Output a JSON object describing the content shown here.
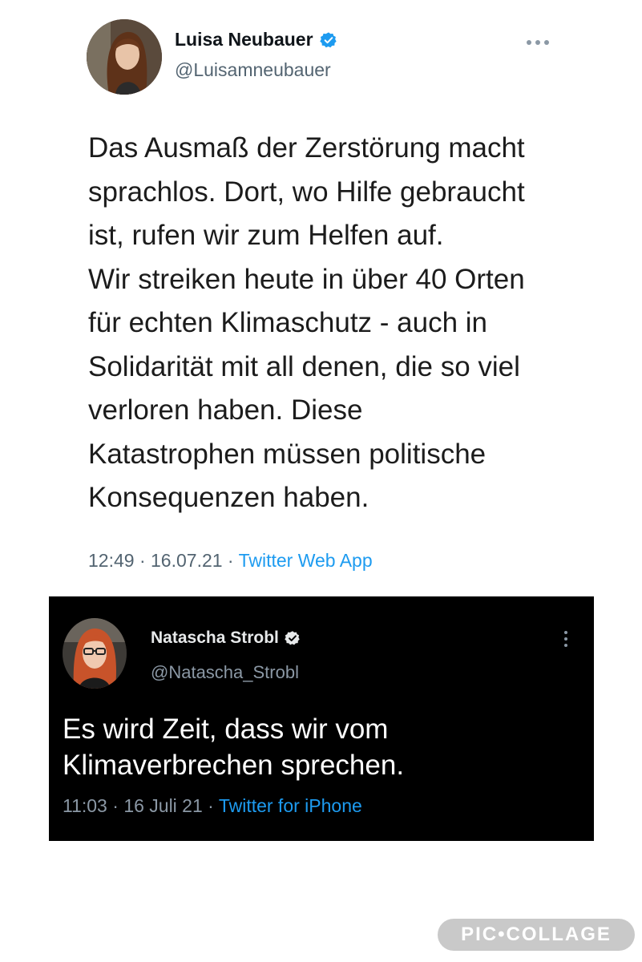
{
  "tweet_1": {
    "author_name": "Luisa Neubauer",
    "handle": "@Luisamneubauer",
    "text_lines": [
      "Das Ausmaß der Zerstörung macht",
      "sprachlos. Dort, wo Hilfe gebraucht",
      "ist, rufen wir zum Helfen auf.",
      "Wir streiken heute in über 40 Orten",
      "für echten Klimaschutz - auch in",
      "Solidarität mit all denen, die so viel",
      "verloren haben. Diese",
      "Katastrophen müssen politische",
      "Konsequenzen haben."
    ],
    "time": "12:49",
    "date": "16.07.21",
    "source": "Twitter Web App",
    "verified_icon": "verified-badge-icon",
    "more_icon": "more-horizontal-icon",
    "theme": "light"
  },
  "tweet_2": {
    "author_name": "Natascha Strobl",
    "handle": "@Natascha_Strobl",
    "text_lines": [
      "Es wird Zeit, dass wir vom",
      "Klimaverbrechen sprechen."
    ],
    "time": "11:03",
    "date": "16 Juli 21",
    "source": "Twitter for iPhone",
    "verified_icon": "verified-badge-icon",
    "more_icon": "more-vertical-icon",
    "theme": "dark"
  },
  "separator": " · ",
  "watermark": "PIC•COLLAGE",
  "colors": {
    "link": "#1d9bf0",
    "verified_light": "#1d9bf0",
    "verified_dark": "#e7e9ea",
    "dark_bg": "#000000",
    "muted": "#536471"
  }
}
